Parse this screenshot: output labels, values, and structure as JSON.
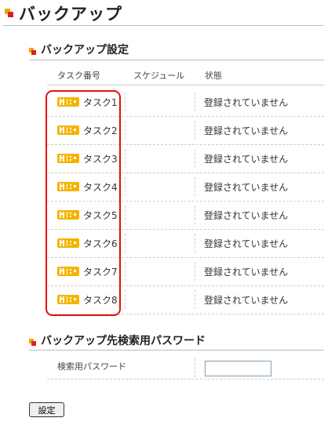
{
  "page": {
    "title": "バックアップ"
  },
  "backup_settings": {
    "heading": "バックアップ設定",
    "columns": [
      "タスク番号",
      "スケジュール",
      "状態"
    ],
    "rows": [
      {
        "task": "タスク1",
        "schedule": "",
        "status": "登録されていません"
      },
      {
        "task": "タスク2",
        "schedule": "",
        "status": "登録されていません"
      },
      {
        "task": "タスク3",
        "schedule": "",
        "status": "登録されていません"
      },
      {
        "task": "タスク4",
        "schedule": "",
        "status": "登録されていません"
      },
      {
        "task": "タスク5",
        "schedule": "",
        "status": "登録されていません"
      },
      {
        "task": "タスク6",
        "schedule": "",
        "status": "登録されていません"
      },
      {
        "task": "タスク7",
        "schedule": "",
        "status": "登録されていません"
      },
      {
        "task": "タスク8",
        "schedule": "",
        "status": "登録されていません"
      }
    ]
  },
  "search_password": {
    "heading": "バックアップ先検索用パスワード",
    "label": "検索用パスワード",
    "value": ""
  },
  "actions": {
    "submit_label": "設定"
  },
  "colors": {
    "bullet_orange": "#f5a300",
    "bullet_red": "#e02020",
    "task_icon": "#f5b400",
    "highlight": "#e01010"
  },
  "icons": {
    "task_icon": "task-toggle-icon",
    "section_bullet": "square-bullet-icon"
  }
}
